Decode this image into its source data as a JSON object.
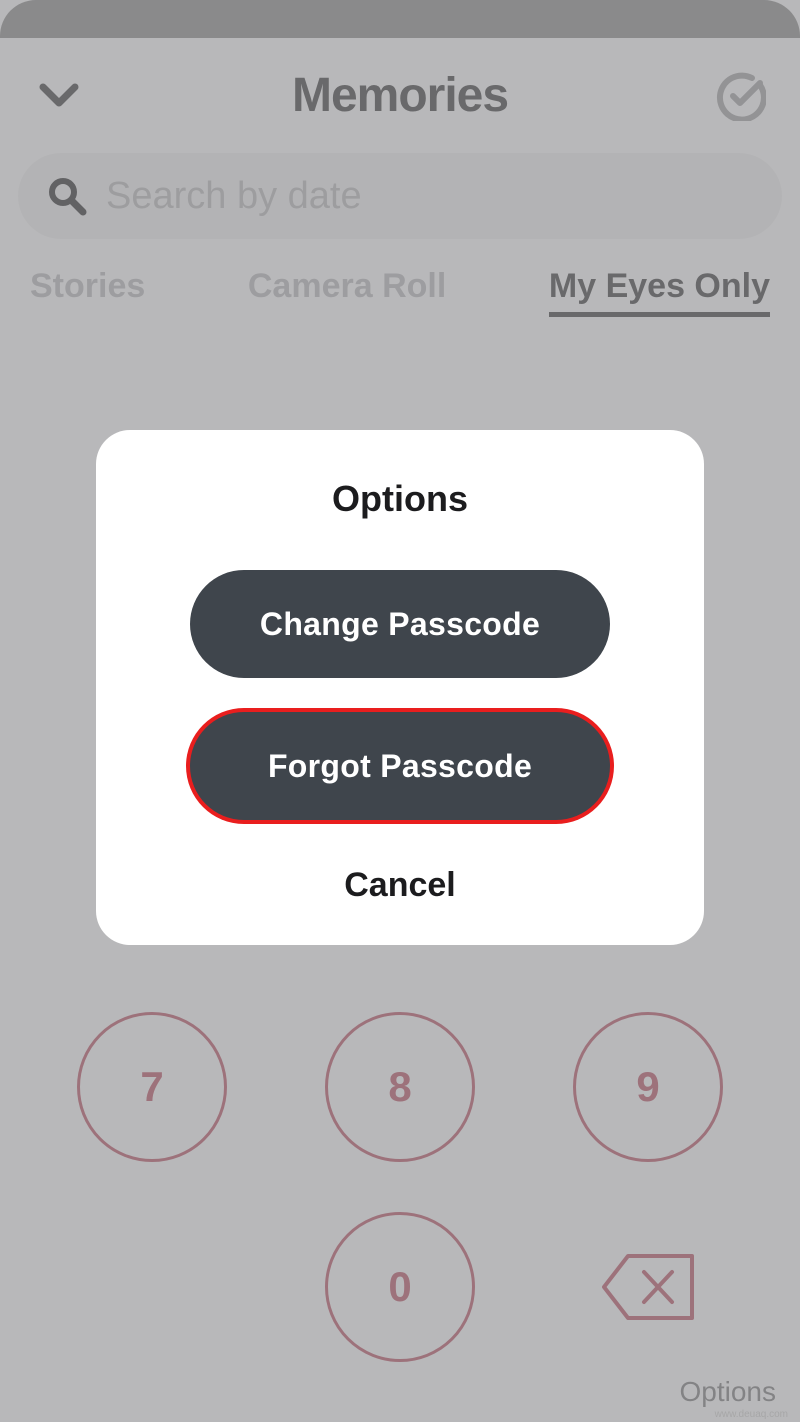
{
  "header": {
    "title": "Memories"
  },
  "search": {
    "placeholder": "Search by date"
  },
  "tabs": {
    "stories": "Stories",
    "camera_roll": "Camera Roll",
    "my_eyes_only": "My Eyes Only"
  },
  "modal": {
    "title": "Options",
    "change_passcode": "Change Passcode",
    "forgot_passcode": "Forgot Passcode",
    "cancel": "Cancel"
  },
  "keypad": {
    "k7": "7",
    "k8": "8",
    "k9": "9",
    "k0": "0"
  },
  "footer": {
    "options_link": "Options"
  },
  "watermark": "www.deuaq.com",
  "colors": {
    "keypad_red": "#a74155",
    "pill_bg": "#3f454c",
    "highlight": "#e91e1e"
  }
}
